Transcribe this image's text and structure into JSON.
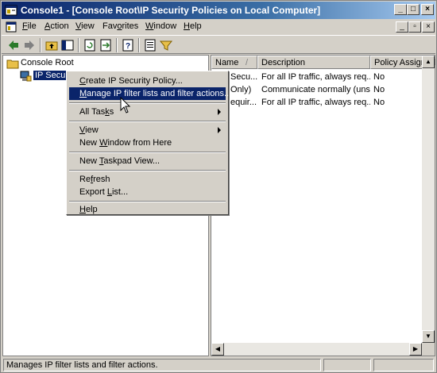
{
  "window": {
    "title": "Console1 - [Console Root\\IP Security Policies on Local Computer]",
    "minimize": "_",
    "maximize": "□",
    "close": "×"
  },
  "menubar": {
    "items": [
      "File",
      "Action",
      "View",
      "Favorites",
      "Window",
      "Help"
    ],
    "mnemonics": [
      "F",
      "A",
      "V",
      "o",
      "W",
      "H"
    ]
  },
  "tree": {
    "root": "Console Root",
    "child": "IP Security Policies on Local Computer"
  },
  "list": {
    "columns": [
      "Name",
      "Description",
      "Policy Assigned"
    ],
    "sort_indicator": "/",
    "rows": [
      {
        "name": "Secu...",
        "description": "For all IP traffic, always req...",
        "assigned": "No"
      },
      {
        "name": "Only)",
        "description": "Communicate normally (uns...",
        "assigned": "No"
      },
      {
        "name": "equir...",
        "description": "For all IP traffic, always req...",
        "assigned": "No"
      }
    ]
  },
  "context_menu": {
    "items": [
      {
        "label": "Create IP Security Policy...",
        "u": "C"
      },
      {
        "label": "Manage IP filter lists and filter actions...",
        "u": "M",
        "highlighted": true
      },
      {
        "label": "All Tasks",
        "u": "k",
        "submenu": true
      },
      {
        "label": "View",
        "u": "V",
        "submenu": true
      },
      {
        "label": "New Window from Here",
        "u": "W"
      },
      {
        "label": "New Taskpad View...",
        "u": "T"
      },
      {
        "label": "Refresh",
        "u": "f"
      },
      {
        "label": "Export List...",
        "u": "L"
      },
      {
        "label": "Help",
        "u": "H"
      }
    ]
  },
  "status": {
    "text": "Manages IP filter lists and filter actions."
  },
  "colors": {
    "title_start": "#0a246a",
    "title_end": "#a6caf0",
    "highlight": "#0a246a",
    "face": "#d4d0c8"
  }
}
